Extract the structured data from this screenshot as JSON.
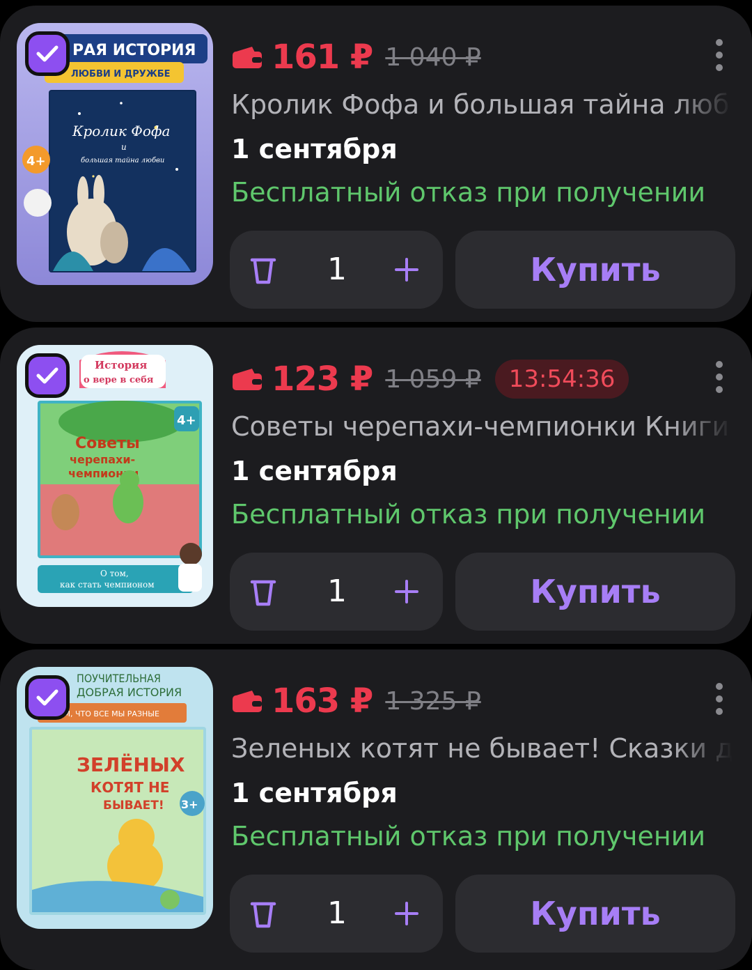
{
  "colors": {
    "price": "#ec3a4e",
    "refund": "#5fc76c",
    "accent": "#8d4ff0",
    "buy_text": "#a77ef6",
    "card_bg": "#1c1c1f"
  },
  "icons": {
    "wallet": "wallet-icon",
    "check": "check-icon",
    "more": "more-vertical-icon",
    "trash": "trash-icon",
    "plus": "plus-icon"
  },
  "items": [
    {
      "cover_lines": [
        "РАЯ ИСТОРИЯ",
        "ЛЮБВИ И ДРУЖБЕ",
        "Кролик Фофа",
        "и",
        "большая тайна любви",
        "4+"
      ],
      "price": "161 ₽",
      "old_price": "1 040 ₽",
      "timer": "",
      "title": "Кролик Фофа и большая тайна любви",
      "date": "1 сентября",
      "refund": "Бесплатный отказ при получении",
      "quantity": "1",
      "buy_label": "Купить",
      "selected": true
    },
    {
      "cover_lines": [
        "История",
        "о вере в себя",
        "Советы",
        "черепахи-",
        "чемпионки",
        "4+",
        "О том,",
        "как стать чемпионом"
      ],
      "price": "123 ₽",
      "old_price": "1 059 ₽",
      "timer": "13:54:36",
      "title": "Советы черепахи-чемпионки Книги",
      "date": "1 сентября",
      "refund": "Бесплатный отказ при получении",
      "quantity": "1",
      "buy_label": "Купить",
      "selected": true
    },
    {
      "cover_lines": [
        "ПОУЧИТЕЛЬНАЯ",
        "ДОБРАЯ ИСТОРИЯ",
        "О ТОМ, ЧТО ВСЕ МЫ РАЗНЫЕ",
        "ЗЕЛЁНЫХ",
        "КОТЯТ НЕ",
        "БЫВАЕТ!",
        "3+"
      ],
      "price": "163 ₽",
      "old_price": "1 325 ₽",
      "timer": "",
      "title": "Зеленых котят не бывает! Сказки для",
      "date": "1 сентября",
      "refund": "Бесплатный отказ при получении",
      "quantity": "1",
      "buy_label": "Купить",
      "selected": true
    }
  ]
}
